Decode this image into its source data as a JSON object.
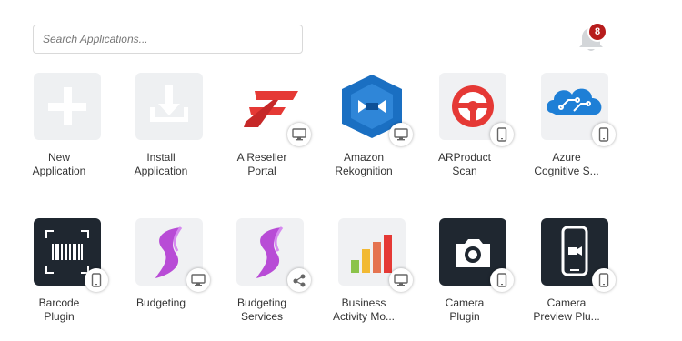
{
  "search": {
    "placeholder": "Search Applications..."
  },
  "notifications": {
    "count": "8"
  },
  "apps": [
    {
      "line1": "New",
      "line2": "Application",
      "icon": "plus-icon",
      "platform": null
    },
    {
      "line1": "Install",
      "line2": "Application",
      "icon": "install-icon",
      "platform": null
    },
    {
      "line1": "A Reseller",
      "line2": "Portal",
      "icon": "reseller-logo-icon",
      "platform": "desktop"
    },
    {
      "line1": "Amazon",
      "line2": "Rekognition",
      "icon": "amazon-rekognition-icon",
      "platform": "desktop"
    },
    {
      "line1": "ARProduct",
      "line2": "Scan",
      "icon": "steering-wheel-icon",
      "platform": "mobile"
    },
    {
      "line1": "Azure",
      "line2": "Cognitive S...",
      "icon": "brain-circuit-icon",
      "platform": "mobile"
    },
    {
      "line1": "Barcode",
      "line2": "Plugin",
      "icon": "barcode-scan-icon",
      "platform": "mobile"
    },
    {
      "line1": "Budgeting",
      "line2": "",
      "icon": "budgeting-s-icon",
      "platform": "desktop"
    },
    {
      "line1": "Budgeting",
      "line2": "Services",
      "icon": "budgeting-s-icon",
      "platform": "service"
    },
    {
      "line1": "Business",
      "line2": "Activity Mo...",
      "icon": "bar-chart-icon",
      "platform": "desktop"
    },
    {
      "line1": "Camera",
      "line2": "Plugin",
      "icon": "camera-icon",
      "platform": "mobile"
    },
    {
      "line1": "Camera",
      "line2": "Preview Plu...",
      "icon": "video-phone-icon",
      "platform": "mobile"
    }
  ],
  "colors": {
    "badge": "#b71c1c",
    "purple": "#b84cd6",
    "red": "#e53935",
    "blue": "#1a6fc2"
  }
}
